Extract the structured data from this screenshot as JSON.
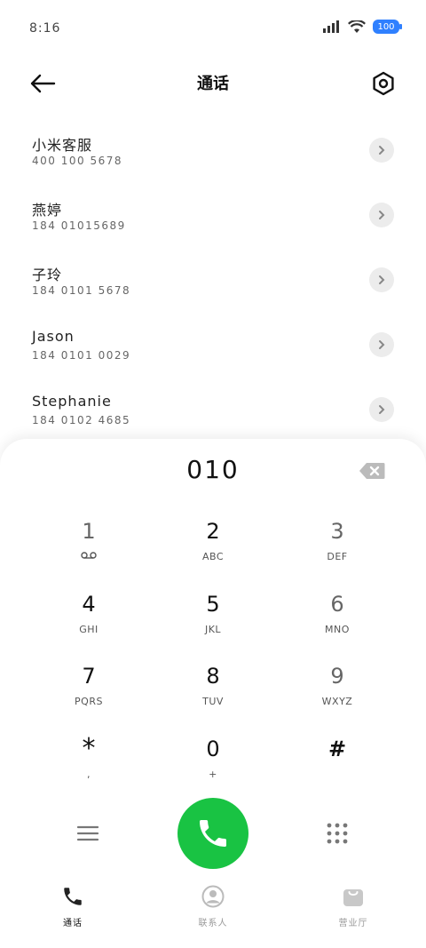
{
  "status_bar": {
    "time": "8:16",
    "battery": "100"
  },
  "header": {
    "title": "通话"
  },
  "contacts": [
    {
      "name": "小米客服",
      "number": "400 100 5678"
    },
    {
      "name": "燕婷",
      "number": "184 01015689"
    },
    {
      "name": "子玲",
      "number": "184 0101 5678"
    },
    {
      "name": "Jason",
      "number": "184 0101 0029"
    },
    {
      "name": "Stephanie",
      "number": "184 0102 4685"
    }
  ],
  "dialer": {
    "entered": "010",
    "keys": [
      {
        "digit": "1",
        "letters": ""
      },
      {
        "digit": "2",
        "letters": "ABC"
      },
      {
        "digit": "3",
        "letters": "DEF"
      },
      {
        "digit": "4",
        "letters": "GHI"
      },
      {
        "digit": "5",
        "letters": "JKL"
      },
      {
        "digit": "6",
        "letters": "MNO"
      },
      {
        "digit": "7",
        "letters": "PQRS"
      },
      {
        "digit": "8",
        "letters": "TUV"
      },
      {
        "digit": "9",
        "letters": "WXYZ"
      },
      {
        "digit": "*",
        "letters": ","
      },
      {
        "digit": "0",
        "letters": "+"
      },
      {
        "digit": "#",
        "letters": ""
      }
    ]
  },
  "nav": {
    "calls": "通话",
    "contacts": "联系人",
    "shop": "营业厅"
  },
  "colors": {
    "call_green": "#19c343",
    "battery_blue": "#2f80ff"
  }
}
